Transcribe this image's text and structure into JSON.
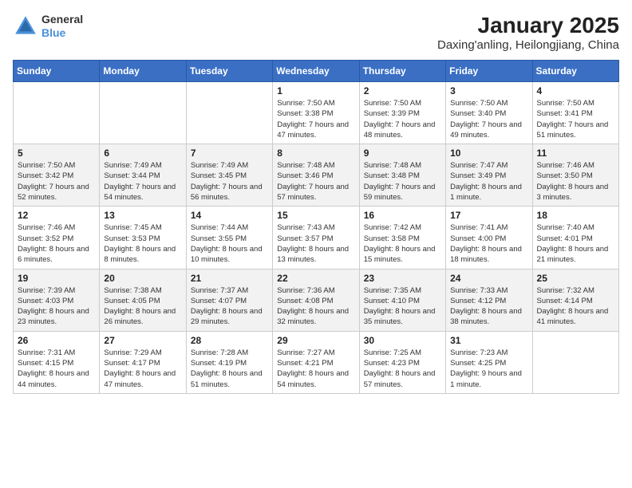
{
  "header": {
    "logo": {
      "line1": "General",
      "line2": "Blue"
    },
    "title": "January 2025",
    "subtitle": "Daxing'anling, Heilongjiang, China"
  },
  "weekdays": [
    "Sunday",
    "Monday",
    "Tuesday",
    "Wednesday",
    "Thursday",
    "Friday",
    "Saturday"
  ],
  "weeks": [
    [
      {
        "day": "",
        "info": ""
      },
      {
        "day": "",
        "info": ""
      },
      {
        "day": "",
        "info": ""
      },
      {
        "day": "1",
        "info": "Sunrise: 7:50 AM\nSunset: 3:38 PM\nDaylight: 7 hours and 47 minutes."
      },
      {
        "day": "2",
        "info": "Sunrise: 7:50 AM\nSunset: 3:39 PM\nDaylight: 7 hours and 48 minutes."
      },
      {
        "day": "3",
        "info": "Sunrise: 7:50 AM\nSunset: 3:40 PM\nDaylight: 7 hours and 49 minutes."
      },
      {
        "day": "4",
        "info": "Sunrise: 7:50 AM\nSunset: 3:41 PM\nDaylight: 7 hours and 51 minutes."
      }
    ],
    [
      {
        "day": "5",
        "info": "Sunrise: 7:50 AM\nSunset: 3:42 PM\nDaylight: 7 hours and 52 minutes."
      },
      {
        "day": "6",
        "info": "Sunrise: 7:49 AM\nSunset: 3:44 PM\nDaylight: 7 hours and 54 minutes."
      },
      {
        "day": "7",
        "info": "Sunrise: 7:49 AM\nSunset: 3:45 PM\nDaylight: 7 hours and 56 minutes."
      },
      {
        "day": "8",
        "info": "Sunrise: 7:48 AM\nSunset: 3:46 PM\nDaylight: 7 hours and 57 minutes."
      },
      {
        "day": "9",
        "info": "Sunrise: 7:48 AM\nSunset: 3:48 PM\nDaylight: 7 hours and 59 minutes."
      },
      {
        "day": "10",
        "info": "Sunrise: 7:47 AM\nSunset: 3:49 PM\nDaylight: 8 hours and 1 minute."
      },
      {
        "day": "11",
        "info": "Sunrise: 7:46 AM\nSunset: 3:50 PM\nDaylight: 8 hours and 3 minutes."
      }
    ],
    [
      {
        "day": "12",
        "info": "Sunrise: 7:46 AM\nSunset: 3:52 PM\nDaylight: 8 hours and 6 minutes."
      },
      {
        "day": "13",
        "info": "Sunrise: 7:45 AM\nSunset: 3:53 PM\nDaylight: 8 hours and 8 minutes."
      },
      {
        "day": "14",
        "info": "Sunrise: 7:44 AM\nSunset: 3:55 PM\nDaylight: 8 hours and 10 minutes."
      },
      {
        "day": "15",
        "info": "Sunrise: 7:43 AM\nSunset: 3:57 PM\nDaylight: 8 hours and 13 minutes."
      },
      {
        "day": "16",
        "info": "Sunrise: 7:42 AM\nSunset: 3:58 PM\nDaylight: 8 hours and 15 minutes."
      },
      {
        "day": "17",
        "info": "Sunrise: 7:41 AM\nSunset: 4:00 PM\nDaylight: 8 hours and 18 minutes."
      },
      {
        "day": "18",
        "info": "Sunrise: 7:40 AM\nSunset: 4:01 PM\nDaylight: 8 hours and 21 minutes."
      }
    ],
    [
      {
        "day": "19",
        "info": "Sunrise: 7:39 AM\nSunset: 4:03 PM\nDaylight: 8 hours and 23 minutes."
      },
      {
        "day": "20",
        "info": "Sunrise: 7:38 AM\nSunset: 4:05 PM\nDaylight: 8 hours and 26 minutes."
      },
      {
        "day": "21",
        "info": "Sunrise: 7:37 AM\nSunset: 4:07 PM\nDaylight: 8 hours and 29 minutes."
      },
      {
        "day": "22",
        "info": "Sunrise: 7:36 AM\nSunset: 4:08 PM\nDaylight: 8 hours and 32 minutes."
      },
      {
        "day": "23",
        "info": "Sunrise: 7:35 AM\nSunset: 4:10 PM\nDaylight: 8 hours and 35 minutes."
      },
      {
        "day": "24",
        "info": "Sunrise: 7:33 AM\nSunset: 4:12 PM\nDaylight: 8 hours and 38 minutes."
      },
      {
        "day": "25",
        "info": "Sunrise: 7:32 AM\nSunset: 4:14 PM\nDaylight: 8 hours and 41 minutes."
      }
    ],
    [
      {
        "day": "26",
        "info": "Sunrise: 7:31 AM\nSunset: 4:15 PM\nDaylight: 8 hours and 44 minutes."
      },
      {
        "day": "27",
        "info": "Sunrise: 7:29 AM\nSunset: 4:17 PM\nDaylight: 8 hours and 47 minutes."
      },
      {
        "day": "28",
        "info": "Sunrise: 7:28 AM\nSunset: 4:19 PM\nDaylight: 8 hours and 51 minutes."
      },
      {
        "day": "29",
        "info": "Sunrise: 7:27 AM\nSunset: 4:21 PM\nDaylight: 8 hours and 54 minutes."
      },
      {
        "day": "30",
        "info": "Sunrise: 7:25 AM\nSunset: 4:23 PM\nDaylight: 8 hours and 57 minutes."
      },
      {
        "day": "31",
        "info": "Sunrise: 7:23 AM\nSunset: 4:25 PM\nDaylight: 9 hours and 1 minute."
      },
      {
        "day": "",
        "info": ""
      }
    ]
  ]
}
